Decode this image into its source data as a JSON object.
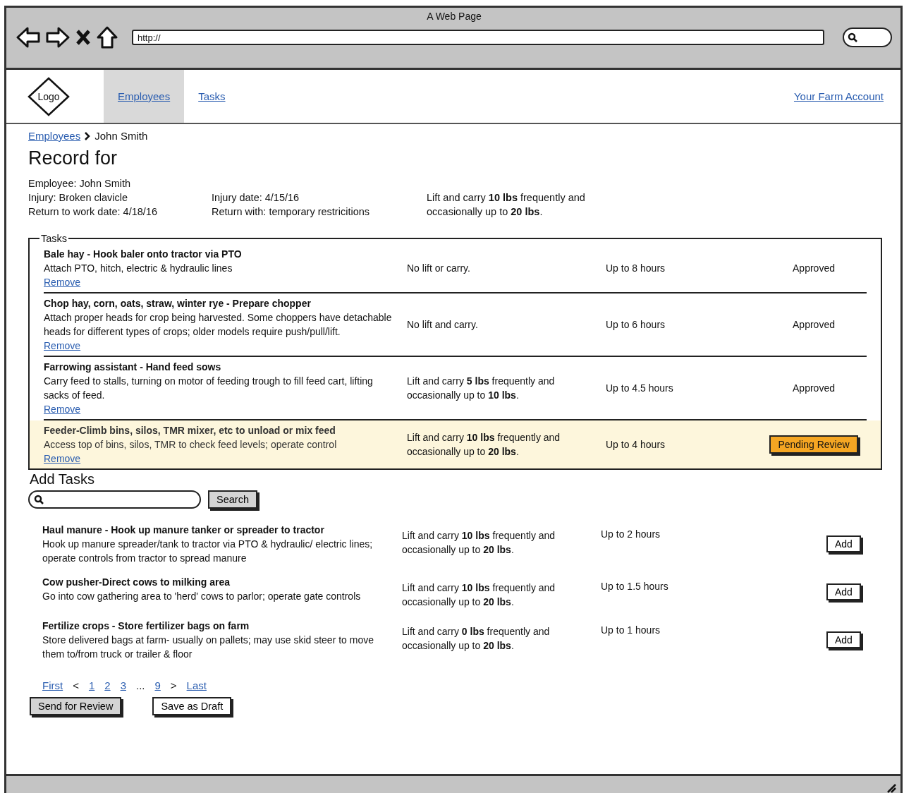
{
  "window": {
    "title": "A Web Page"
  },
  "browser": {
    "address": "http://"
  },
  "nav": {
    "logo": "Logo",
    "tabs": [
      {
        "label": "Employees",
        "selected": true
      },
      {
        "label": "Tasks",
        "selected": false
      }
    ],
    "account": "Your Farm Account"
  },
  "breadcrumb": {
    "parent": "Employees",
    "current": "John Smith"
  },
  "heading": "Record for",
  "details": {
    "column_1": [
      "Employee: John Smith",
      "Injury: Broken clavicle",
      "Return to work date: 4/18/16"
    ],
    "column_2": [
      "Injury date: 4/15/16",
      "Return with: temporary restricitions"
    ],
    "restriction": "Lift and carry **10 lbs** frequently and occasionally up to **20 lbs**."
  },
  "tasks": {
    "legend": "Tasks",
    "rows": [
      {
        "title": "Bale hay - Hook baler onto tractor via PTO",
        "description": "Attach PTO, hitch, electric & hydraulic lines",
        "remove": "Remove",
        "restriction": "No lift or carry.",
        "hours": "Up to 8 hours",
        "status": "Approved",
        "kind": "text",
        "highlighted": false
      },
      {
        "title": "Chop hay, corn, oats, straw, winter rye - Prepare chopper",
        "description": "Attach proper heads for crop being harvested. Some choppers have detachable heads for different types of crops; older models require push/pull/lift.",
        "remove": "Remove",
        "restriction": "No lift and carry.",
        "hours": "Up to 6 hours",
        "status": "Approved",
        "kind": "text",
        "highlighted": false
      },
      {
        "title": "Farrowing assistant - Hand feed sows",
        "description": "Carry feed to stalls, turning on motor of feeding trough to fill feed cart, lifting sacks of feed.",
        "remove": "Remove",
        "restriction": "Lift and carry **5 lbs** frequently and occasionally up to **10 lbs**.",
        "hours": "Up to 4.5 hours",
        "status": "Approved",
        "kind": "text",
        "highlighted": false
      },
      {
        "title": "Feeder-Climb bins, silos, TMR mixer, etc to unload or mix feed",
        "description": "Access top of bins, silos, TMR to check feed levels; operate control",
        "remove": "Remove",
        "restriction": "Lift and carry **10 lbs** frequently and occasionally up to **20 lbs**.",
        "hours": "Up to 4 hours",
        "status": "Pending Review",
        "kind": "badge",
        "highlighted": true
      }
    ]
  },
  "add_tasks": {
    "heading": "Add Tasks",
    "search_button": "Search",
    "results": [
      {
        "title": "Haul manure - Hook up manure tanker or spreader to tractor",
        "description": "Hook up manure spreader/tank to tractor via PTO & hydraulic/ electric lines; operate controls from tractor to spread manure",
        "restriction": "Lift and carry **10 lbs** frequently and occasionally up to **20 lbs**.",
        "hours": "Up to 2 hours",
        "action": "Add"
      },
      {
        "title": "Cow pusher-Direct cows to milking area",
        "description": "Go into cow gathering area to 'herd' cows to parlor; operate gate controls",
        "restriction": "Lift and carry **10 lbs** frequently and occasionally up to **20 lbs**.",
        "hours": "Up to 1.5 hours",
        "action": "Add"
      },
      {
        "title": "Fertilize crops - Store fertilizer bags on farm",
        "description": "Store delivered bags at farm- usually on pallets; may use skid steer to move them to/from truck or trailer & floor",
        "restriction": "Lift and carry **0 lbs** frequently and occasionally up to **20 lbs**.",
        "hours": "Up to 1 hours",
        "action": "Add"
      }
    ]
  },
  "pagination": [
    {
      "label": "First",
      "kind": "link"
    },
    {
      "label": "<",
      "kind": "text"
    },
    {
      "label": "1",
      "kind": "link"
    },
    {
      "label": "2",
      "kind": "link"
    },
    {
      "label": "3",
      "kind": "link"
    },
    {
      "label": "...",
      "kind": "text"
    },
    {
      "label": "9",
      "kind": "link"
    },
    {
      "label": ">",
      "kind": "text"
    },
    {
      "label": "Last",
      "kind": "link"
    }
  ],
  "buttons": [
    {
      "label": "Send for Review",
      "kind": "primary"
    },
    {
      "label": "Save as Draft",
      "kind": "secondary"
    }
  ]
}
